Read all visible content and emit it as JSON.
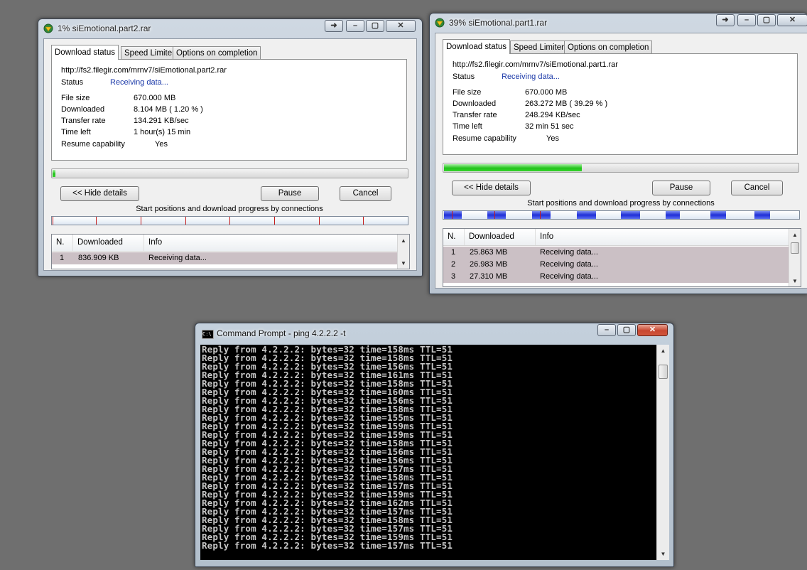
{
  "windows": [
    {
      "title": "1% siEmotional.part2.rar",
      "tabs": [
        "Download status",
        "Speed Limiter",
        "Options on completion"
      ],
      "url": "http://fs2.filegir.com/mrnv7/siEmotional.part2.rar",
      "status_label": "Status",
      "status_value": "Receiving data...",
      "file_size_label": "File size",
      "file_size": "670.000  MB",
      "downloaded_label": "Downloaded",
      "downloaded": "8.104  MB  ( 1.20 % )",
      "transfer_rate_label": "Transfer rate",
      "transfer_rate": "134.291  KB/sec",
      "time_left_label": "Time left",
      "time_left": "1 hour(s) 15 min",
      "resume_label": "Resume capability",
      "resume": "Yes",
      "progress_percent": 1.2,
      "hide_details": "<< Hide details",
      "pause": "Pause",
      "cancel": "Cancel",
      "connections_caption": "Start positions and download progress by connections",
      "columns": [
        "N.",
        "Downloaded",
        "Info"
      ],
      "rows": [
        {
          "n": "1",
          "downloaded": "836.909  KB",
          "info": "Receiving data..."
        }
      ]
    },
    {
      "title": "39% siEmotional.part1.rar",
      "tabs": [
        "Download status",
        "Speed Limiter",
        "Options on completion"
      ],
      "url": "http://fs2.filegir.com/mrnv7/siEmotional.part1.rar",
      "status_label": "Status",
      "status_value": "Receiving data...",
      "file_size_label": "File size",
      "file_size": "670.000  MB",
      "downloaded_label": "Downloaded",
      "downloaded": "263.272  MB  ( 39.29 % )",
      "transfer_rate_label": "Transfer rate",
      "transfer_rate": "248.294  KB/sec",
      "time_left_label": "Time left",
      "time_left": "32 min 51 sec",
      "resume_label": "Resume capability",
      "resume": "Yes",
      "progress_percent": 39.29,
      "hide_details": "<< Hide details",
      "pause": "Pause",
      "cancel": "Cancel",
      "connections_caption": "Start positions and download progress by connections",
      "columns": [
        "N.",
        "Downloaded",
        "Info"
      ],
      "rows": [
        {
          "n": "1",
          "downloaded": "25.863  MB",
          "info": "Receiving data..."
        },
        {
          "n": "2",
          "downloaded": "26.983  MB",
          "info": "Receiving data..."
        },
        {
          "n": "3",
          "downloaded": "27.310  MB",
          "info": "Receiving data..."
        }
      ]
    }
  ],
  "cmd": {
    "title": "Command Prompt - ping  4.2.2.2 -t",
    "icon_text": "C:\\",
    "lines": [
      "Reply from 4.2.2.2: bytes=32 time=158ms TTL=51",
      "Reply from 4.2.2.2: bytes=32 time=158ms TTL=51",
      "Reply from 4.2.2.2: bytes=32 time=156ms TTL=51",
      "Reply from 4.2.2.2: bytes=32 time=161ms TTL=51",
      "Reply from 4.2.2.2: bytes=32 time=158ms TTL=51",
      "Reply from 4.2.2.2: bytes=32 time=160ms TTL=51",
      "Reply from 4.2.2.2: bytes=32 time=156ms TTL=51",
      "Reply from 4.2.2.2: bytes=32 time=158ms TTL=51",
      "Reply from 4.2.2.2: bytes=32 time=155ms TTL=51",
      "Reply from 4.2.2.2: bytes=32 time=159ms TTL=51",
      "Reply from 4.2.2.2: bytes=32 time=159ms TTL=51",
      "Reply from 4.2.2.2: bytes=32 time=158ms TTL=51",
      "Reply from 4.2.2.2: bytes=32 time=156ms TTL=51",
      "Reply from 4.2.2.2: bytes=32 time=156ms TTL=51",
      "Reply from 4.2.2.2: bytes=32 time=157ms TTL=51",
      "Reply from 4.2.2.2: bytes=32 time=158ms TTL=51",
      "Reply from 4.2.2.2: bytes=32 time=157ms TTL=51",
      "Reply from 4.2.2.2: bytes=32 time=159ms TTL=51",
      "Reply from 4.2.2.2: bytes=32 time=162ms TTL=51",
      "Reply from 4.2.2.2: bytes=32 time=157ms TTL=51",
      "Reply from 4.2.2.2: bytes=32 time=158ms TTL=51",
      "Reply from 4.2.2.2: bytes=32 time=157ms TTL=51",
      "Reply from 4.2.2.2: bytes=32 time=159ms TTL=51",
      "Reply from 4.2.2.2: bytes=32 time=157ms TTL=51"
    ]
  },
  "colors": {
    "desktop": "#6f6f6f",
    "progress_green": "#22c31b",
    "status_blue": "#1c3aa9",
    "row_selected": "#cbc0c5",
    "console_bg": "#000000",
    "console_text": "#c8c8c8"
  }
}
